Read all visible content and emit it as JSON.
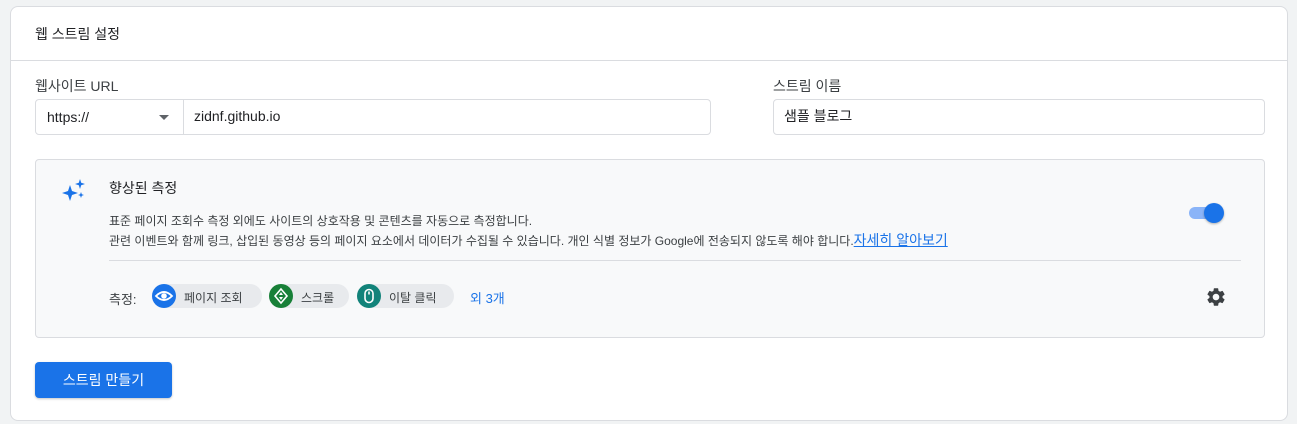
{
  "card": {
    "title": "웹 스트림 설정"
  },
  "website_url": {
    "label": "웹사이트 URL",
    "protocol": "https://",
    "value": "zidnf.github.io"
  },
  "stream_name": {
    "label": "스트림 이름",
    "value": "샘플 블로그"
  },
  "enhanced": {
    "title": "향상된 측정",
    "desc_line1": "표준 페이지 조회수 측정 외에도 사이트의 상호작용 및 콘텐츠를 자동으로 측정합니다.",
    "desc_line2": "관련 이벤트와 함께 링크, 삽입된 동영상 등의 페이지 요소에서 데이터가 수집될 수 있습니다. 개인 식별 정보가 Google에 전송되지 않도록 해야 합니다.",
    "learn_more": "자세히 알아보기",
    "toggle_on": true,
    "measure_label": "측정:",
    "chips": [
      {
        "label": "페이지 조회",
        "icon": "eye-icon",
        "color": "#1a73e8"
      },
      {
        "label": "스크롤",
        "icon": "scroll-icon",
        "color": "#188038"
      },
      {
        "label": "이탈 클릭",
        "icon": "mouse-icon",
        "color": "#12837a"
      }
    ],
    "more": "외 3개"
  },
  "actions": {
    "create_label": "스트림 만들기"
  },
  "colors": {
    "accent": "#1a73e8",
    "toggle_track": "#8ab4f8"
  }
}
